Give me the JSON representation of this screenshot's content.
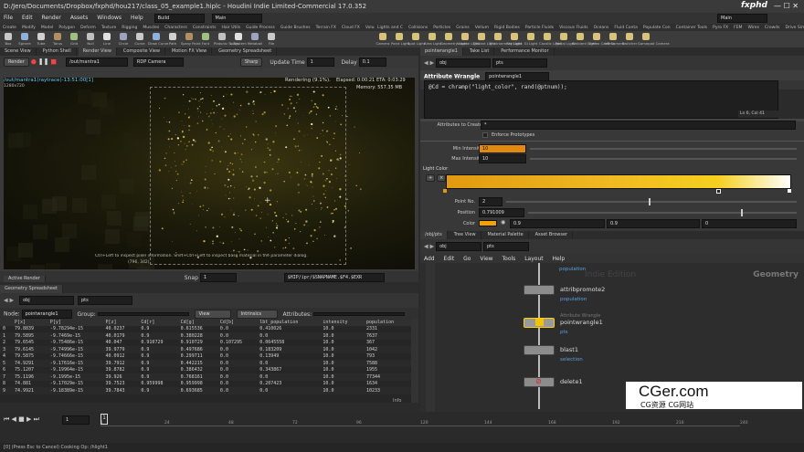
{
  "window": {
    "title": "D:/Jero/Documents/Dropbox/fxphd/hou217/class_05_example1.hiplc - Houdini Indie Limited-Commercial 17.0.352"
  },
  "menu": {
    "items": [
      "File",
      "Edit",
      "Render",
      "Assets",
      "Windows",
      "Help"
    ],
    "desktop": "Build",
    "context": "Main",
    "right_context": "Main"
  },
  "shelf_tabs_left": [
    "Create",
    "Modify",
    "Model",
    "Polygon",
    "Deform",
    "Texture",
    "Rigging",
    "Muscles",
    "Characters",
    "Constraints",
    "Hair Utils",
    "Guide Process",
    "Guide Brushes",
    "Terrain FX",
    "Cloud FX",
    "Volume"
  ],
  "shelf_tabs_right": [
    "Lights and C",
    "Collisions",
    "Particles",
    "Grains",
    "Vellum",
    "Rigid Bodies",
    "Particle Fluids",
    "Viscous Fluids",
    "Oceans",
    "Fluid Conta",
    "Populate Con",
    "Container Tools",
    "Pyro FX",
    "FEM",
    "Wires",
    "Crowds",
    "Drive Simula"
  ],
  "tools_left": [
    "Box",
    "Sphere",
    "Tube",
    "Torus",
    "Grid",
    "Null",
    "Line",
    "Circle",
    "Curve",
    "Draw Curve",
    "Path",
    "Spray Paint",
    "Font",
    "Platonic Solids",
    "L-System",
    "Metaball",
    "File"
  ],
  "tools_right": [
    "Camera",
    "Point Light",
    "Spot Light",
    "Area Light",
    "Geometry Light",
    "Volume Light",
    "Distant Light",
    "Environment Light",
    "Sky Light",
    "GI Light",
    "Caustic Light",
    "Portal Light",
    "Ambient Light",
    "Stereo Camera",
    "VR Camera",
    "Switcher",
    "Gamepad Camera"
  ],
  "left_pane": {
    "tabs": [
      "Scene View",
      "Python Shell",
      "Render View",
      "Composite View",
      "Motion FX View",
      "Geometry Spreadsheet"
    ],
    "render_button": "Render",
    "renderer": "/out/mantra1",
    "camera": "RDP Camera",
    "sharp": "Sharp",
    "update_time_label": "Update Time",
    "update_time": "1",
    "delay_label": "Delay",
    "delay": "0.1",
    "render_path": "/out/mantra1(raytrace)-13:51:00[1]",
    "resolution": "1280x720",
    "rendering": "Rendering (9.1%).",
    "elapsed": "Elapsed: 0:00:21",
    "eta": "ETA: 0:03:29",
    "memory": "Memory: 557.35 MB",
    "hint": "Ctrl+Left to inspect pixel information. Shift+Ctrl+Left to inspect base material in the parameter dialog.",
    "coords": "(796, 342)",
    "snapshot_tab": "Active Render",
    "snap_label": "Snap",
    "snap_value": "1",
    "ip_path": "$HIP/ipr/$SNAPNAME.$F4.$EXR"
  },
  "spreadsheet": {
    "tab": "Geometry Spreadsheet",
    "obj": "obj",
    "geo": "pts",
    "node_label": "Node:",
    "node": "pointwrangle1",
    "group_label": "Group:",
    "view": "View",
    "intrinsics": "Intrinsics",
    "attributes_label": "Attributes:",
    "columns": [
      "",
      "P[x]",
      "P[y]",
      "P[z]",
      "Cd[r]",
      "Cd[g]",
      "Cd[b]",
      "lbt_population",
      "intensity",
      "population"
    ],
    "rows": [
      [
        "0",
        "79.8839",
        "-9.78294e-15",
        "40.0237",
        "0.9",
        "0.615536",
        "0.0",
        "0.410026",
        "10.0",
        "2331"
      ],
      [
        "1",
        "79.5895",
        "-9.7469e-15",
        "40.0179",
        "0.9",
        "0.380228",
        "0.0",
        "0.0",
        "10.0",
        "7637"
      ],
      [
        "2",
        "79.6545",
        "-9.75486e-15",
        "40.047",
        "0.910729",
        "0.910729",
        "0.107295",
        "0.0645558",
        "10.0",
        "367"
      ],
      [
        "3",
        "79.6145",
        "-9.74996e-15",
        "39.9779",
        "0.9",
        "0.497686",
        "0.0",
        "0.183209",
        "10.0",
        "1042"
      ],
      [
        "4",
        "79.5875",
        "-9.74666e-15",
        "40.0912",
        "0.9",
        "0.299711",
        "0.0",
        "0.13949",
        "10.0",
        "793"
      ],
      [
        "5",
        "74.9291",
        "-9.17616e-15",
        "39.7912",
        "0.9",
        "0.442215",
        "0.0",
        "0.0",
        "10.0",
        "7588"
      ],
      [
        "6",
        "75.1207",
        "-9.19964e-15",
        "39.8782",
        "0.9",
        "0.386432",
        "0.0",
        "0.343867",
        "10.0",
        "1955"
      ],
      [
        "7",
        "75.1196",
        "-9.1995e-15",
        "39.926",
        "0.9",
        "0.768161",
        "0.0",
        "0.0",
        "10.0",
        "77344"
      ],
      [
        "8",
        "74.881",
        "-9.17029e-15",
        "39.7523",
        "0.959998",
        "0.959998",
        "0.0",
        "0.207423",
        "10.0",
        "1634"
      ],
      [
        "9",
        "74.9921",
        "-9.18389e-15",
        "39.7843",
        "0.9",
        "0.693685",
        "0.0",
        "0.0",
        "10.0",
        "10233"
      ]
    ],
    "footer": "Info"
  },
  "right_pane": {
    "tabs": [
      "pointwrangle1",
      "Take List",
      "Performance Monitor"
    ],
    "node_type": "Attribute Wrangle",
    "node_name": "pointwrangle1",
    "group_field": "pts",
    "code": "@Cd = chramp(\"light_color\", rand(@ptnum));",
    "cursor_pos": "Ln 6, Col 41",
    "attributes_to_create_label": "Attributes to Create",
    "attributes_to_create": "*",
    "enforce_prototypes": "Enforce Prototypes",
    "min_intensity_label": "Min Intensity",
    "min_intensity": "10",
    "max_intensity_label": "Max Intensity",
    "max_intensity": "10",
    "ramp_label": "Light Color",
    "point_no_label": "Point No.",
    "point_no": "2",
    "position_label": "Position",
    "position": "0.791009",
    "color_label": "Color",
    "color_r": "0.9",
    "color_g": "0.9",
    "color_b": "0",
    "ramp_colors": [
      "#e09a10",
      "#f0b820",
      "#f5d020",
      "#ffffff"
    ]
  },
  "network": {
    "path": "/obj/pts",
    "tabs": [
      "/obj/pts",
      "Tree View",
      "Material Palette",
      "Asset Browser"
    ],
    "obj": "obj",
    "geo": "pts",
    "menus": [
      "Add",
      "Edit",
      "Go",
      "View",
      "Tools",
      "Layout",
      "Help"
    ],
    "watermark": "Indie Edition",
    "context": "Geometry",
    "nodes": [
      {
        "name": "population",
        "kind": "label"
      },
      {
        "name": "attribpromote2",
        "sub": "population"
      },
      {
        "name": "pointwrangle1",
        "type": "Attribute Wrangle",
        "sub": "pts"
      },
      {
        "name": "blast1",
        "sub": "selection"
      },
      {
        "name": "delete1"
      }
    ]
  },
  "timeline": {
    "frame": "1",
    "ticks": [
      "1",
      "24",
      "48",
      "72",
      "96",
      "120",
      "144",
      "168",
      "192",
      "216",
      "240"
    ],
    "status": "[0] (Press Esc to Cancel) Cooking Op: /hlight1"
  },
  "brand": {
    "site": "CGer.com",
    "sub": "CG资源 CG网站",
    "top": "fxphd"
  },
  "colors": {
    "accent": "#f5a100",
    "panel": "#3a3a3a",
    "blue": "#5aa0e0"
  }
}
